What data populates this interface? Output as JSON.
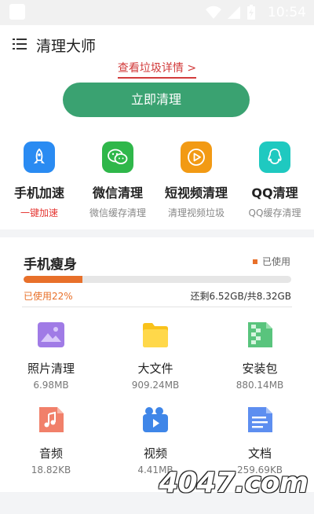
{
  "status_bar": {
    "time": "10:54"
  },
  "app_bar": {
    "title": "清理大师",
    "menu_icon": "menu-icon"
  },
  "detail_link": "查看垃圾详情 >",
  "clean_button": "立即清理",
  "features": [
    {
      "icon": "rocket-icon",
      "color": "#2a8bf2",
      "title": "手机加速",
      "subtitle": "一键加速",
      "subtitle_highlight": true
    },
    {
      "icon": "wechat-icon",
      "color": "#2fb74a",
      "title": "微信清理",
      "subtitle": "微信缓存清理",
      "subtitle_highlight": false
    },
    {
      "icon": "video-play-icon",
      "color": "#f29a14",
      "title": "短视频清理",
      "subtitle": "清理视频垃圾",
      "subtitle_highlight": false
    },
    {
      "icon": "qq-icon",
      "color": "#1fc9c0",
      "title": "QQ清理",
      "subtitle": "QQ缓存清理",
      "subtitle_highlight": false
    }
  ],
  "storage": {
    "title": "手机瘦身",
    "legend": "已使用",
    "used_percent": 22,
    "used_label": "已使用22%",
    "remaining_label": "还剩6.52GB/共8.32GB",
    "accent": "#e8702a"
  },
  "files": [
    {
      "name": "照片清理",
      "size": "6.98MB",
      "icon": "photo-icon"
    },
    {
      "name": "大文件",
      "size": "909.24MB",
      "icon": "folder-icon"
    },
    {
      "name": "安装包",
      "size": "880.14MB",
      "icon": "package-icon"
    },
    {
      "name": "音频",
      "size": "18.82KB",
      "icon": "music-icon"
    },
    {
      "name": "视频",
      "size": "4.41MB",
      "icon": "video-icon"
    },
    {
      "name": "文档",
      "size": "259.69KB",
      "icon": "document-icon"
    }
  ],
  "watermark": "4047.com"
}
